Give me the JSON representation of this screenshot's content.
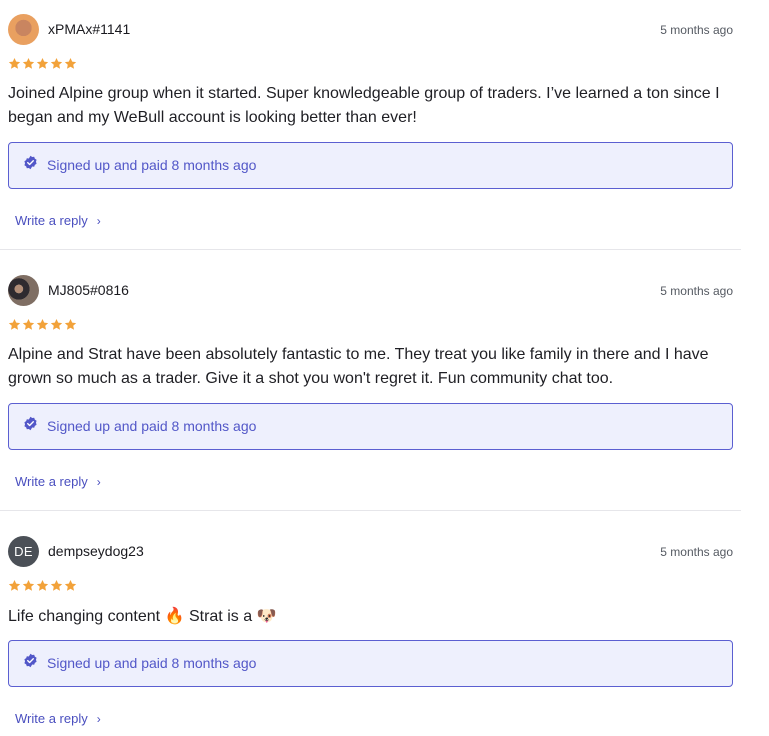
{
  "colors": {
    "accent": "#5b5fd1",
    "verify_bg": "#eef0fd",
    "star": "#f2a23a"
  },
  "reviews": [
    {
      "username": "xPMAx#1141",
      "time": "5 months ago",
      "rating": 5,
      "text": "Joined Alpine group when it started. Super knowledgeable group of traders. I’ve learned a ton since I began and my WeBull account is looking better than ever!",
      "verified": "Signed up and paid 8 months ago",
      "reply": "Write a reply"
    },
    {
      "username": "MJ805#0816",
      "time": "5 months ago",
      "rating": 5,
      "text": "Alpine and Strat have been absolutely fantastic to me. They treat you like family in there and I have grown so much as a trader. Give it a shot you won't regret it. Fun community chat too.",
      "verified": "Signed up and paid 8 months ago",
      "reply": "Write a reply"
    },
    {
      "username": "dempseydog23",
      "avatar_initials": "DE",
      "time": "5 months ago",
      "rating": 5,
      "text_before": "Life changing content",
      "emoji_fire": "🔥",
      "text_middle": "Strat is a",
      "emoji_dog": "🐶",
      "verified": "Signed up and paid 8 months ago",
      "reply": "Write a reply"
    }
  ]
}
